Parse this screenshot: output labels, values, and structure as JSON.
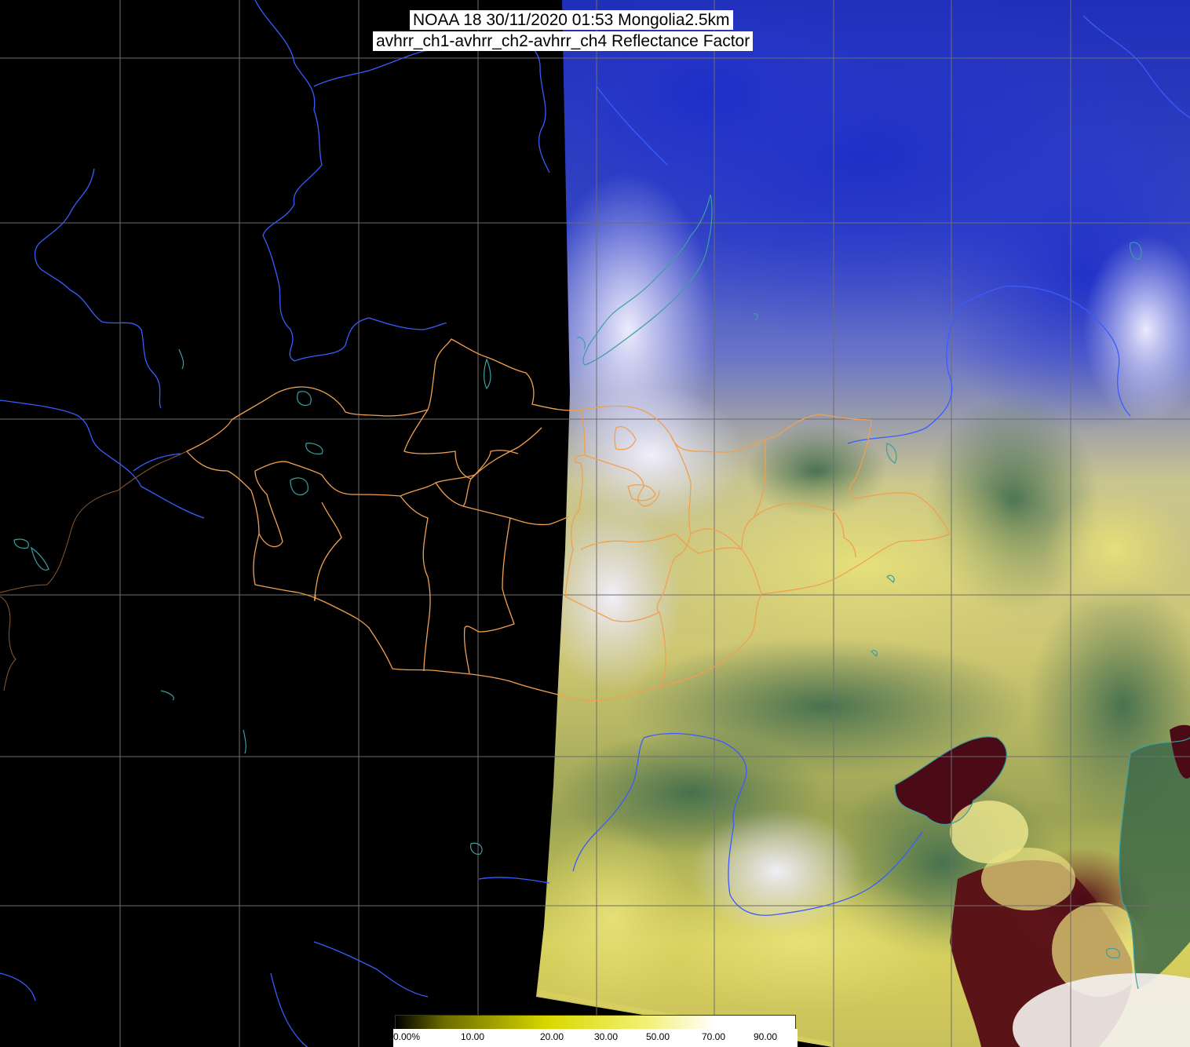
{
  "title": {
    "line1": "NOAA 18 30/11/2020 01:53 Mongolia2.5km",
    "line2": "avhrr_ch1-avhrr_ch2-avhrr_ch4 Reflectance Factor"
  },
  "colorbar": {
    "labels": [
      "0.00%",
      "10.00",
      "20.00",
      "30.00",
      "50.00",
      "70.00",
      "90.00"
    ],
    "values": [
      0,
      10,
      20,
      30,
      50,
      70,
      90
    ],
    "colors": {
      "low": "#000000",
      "mid_low": "#6b6b00",
      "mid": "#d8d800",
      "mid_high": "#f2f070",
      "high": "#ffffff"
    }
  },
  "map_colors": {
    "background": "#000000",
    "graticule": "#6e6e6e",
    "admin_borders": "#f0a050",
    "rivers": "#3a5cff",
    "lakes": "#3aa0a0"
  }
}
